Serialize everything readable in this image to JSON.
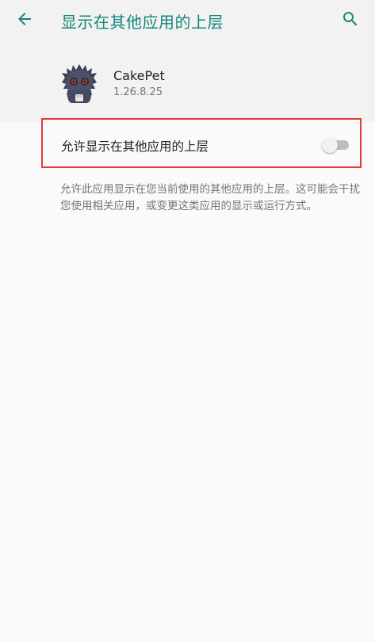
{
  "toolbar": {
    "title": "显示在其他应用的上层",
    "back_icon": "arrow-back-icon",
    "search_icon": "search-icon",
    "accent_color": "#148579"
  },
  "app": {
    "name": "CakePet",
    "version": "1.26.8.25",
    "icon": "cakepet-app-icon"
  },
  "setting": {
    "label": "允许显示在其他应用的上层",
    "toggle_state": "off",
    "highlight_color": "#e53935"
  },
  "summary": {
    "text": "允许此应用显示在您当前使用的其他应用的上层。这可能会干扰您使用相关应用，或变更这类应用的显示或运行方式。"
  }
}
